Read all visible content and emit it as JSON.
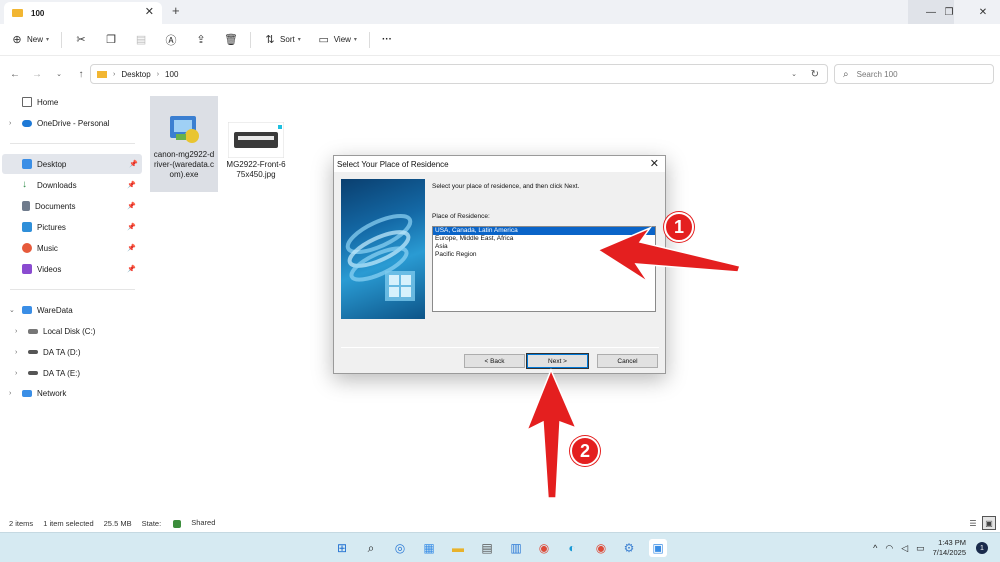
{
  "window": {
    "tab_title": "100",
    "new_tab": "+",
    "minimize": "—",
    "maximize": "❐",
    "close": "✕"
  },
  "toolbar": {
    "new_label": "New",
    "sort_label": "Sort",
    "view_label": "View",
    "more_label": "···"
  },
  "address": {
    "crumbs": [
      "Desktop",
      "100"
    ],
    "search_placeholder": "Search 100"
  },
  "sidebar": {
    "items": [
      {
        "label": "Home"
      },
      {
        "label": "OneDrive - Personal"
      },
      {
        "label": "Desktop"
      },
      {
        "label": "Downloads"
      },
      {
        "label": "Documents"
      },
      {
        "label": "Pictures"
      },
      {
        "label": "Music"
      },
      {
        "label": "Videos"
      },
      {
        "label": "WareData"
      },
      {
        "label": "Local Disk (C:)"
      },
      {
        "label": "DA TA (D:)"
      },
      {
        "label": "DA TA (E:)"
      },
      {
        "label": "Network"
      }
    ]
  },
  "files": [
    {
      "name": "canon-mg2922-driver-(waredata.com).exe",
      "line1": "canon-mg2922-d",
      "line2": "river-(waredata.c",
      "line3": "om).exe"
    },
    {
      "name": "MG2922-Front-675x450.jpg",
      "line1": "MG2922-Front-6",
      "line2": "75x450.jpg"
    }
  ],
  "dialog": {
    "title": "Select Your Place of Residence",
    "close": "✕",
    "instruction": "Select your place of residence, and then click Next.",
    "list_label": "Place of Residence:",
    "options": [
      "USA, Canada, Latin America",
      "Europe, Middle East, Africa",
      "Asia",
      "Pacific Region"
    ],
    "selected_index": 0,
    "back_label": "< Back",
    "next_label": "Next >",
    "cancel_label": "Cancel"
  },
  "status": {
    "items_count": "2 items",
    "selected": "1 item selected",
    "size": "25.5 MB",
    "state_label": "State:",
    "state_value": "Shared"
  },
  "taskbar": {
    "time": "1:43 PM",
    "date": "7/14/2025",
    "notification_count": "1"
  },
  "annotations": {
    "marker1": "1",
    "marker2": "2",
    "arrow_color": "#e41f1f"
  },
  "colors": {
    "accent": "#0a64c8",
    "folder": "#f2b632"
  }
}
